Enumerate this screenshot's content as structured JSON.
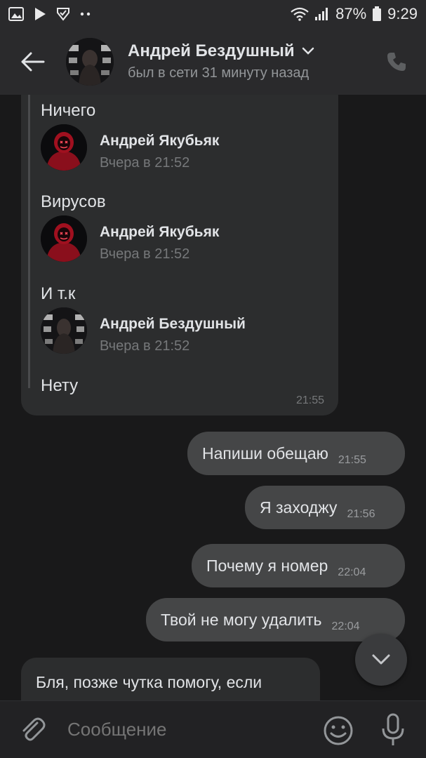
{
  "status_bar": {
    "battery": "87%",
    "time": "9:29",
    "left_icons": [
      "gallery-icon",
      "play-icon",
      "check-shield-icon",
      "more-dots-icon"
    ],
    "right_icons": [
      "wifi-icon",
      "signal-icon",
      "battery-icon"
    ]
  },
  "header": {
    "name": "Андрей Бездушный",
    "status": "был в сети 31 минуту назад",
    "icons": [
      "back-arrow-icon",
      "chevron-down-icon",
      "phone-icon"
    ]
  },
  "forwarded": {
    "top_text": "Ничего",
    "entries": [
      {
        "author": "Андрей Якубьяк",
        "date": "Вчера в 21:52",
        "text": "Вирусов"
      },
      {
        "author": "Андрей Якубьяк",
        "date": "Вчера в 21:52",
        "text": "И т.к"
      },
      {
        "author": "Андрей Бездушный",
        "date": "Вчера в 21:52",
        "text": "Нету"
      }
    ],
    "time": "21:55"
  },
  "outgoing": [
    {
      "text": "Напиши обещаю",
      "time": "21:55"
    },
    {
      "text": "Я заходжу",
      "time": "21:56"
    },
    {
      "text": "Почему я номер",
      "time": "22:04"
    },
    {
      "text": "Твой не могу удалить",
      "time": "22:04"
    }
  ],
  "incoming_last": {
    "text": "Бля, позже чутка помогу, если"
  },
  "composer": {
    "placeholder": "Сообщение",
    "icons": [
      "attach-icon",
      "emoji-icon",
      "mic-icon"
    ]
  },
  "colors": {
    "background": "#19191a",
    "bar": "#2a2a2c",
    "bubble_in": "#2c2d2e",
    "bubble_out": "#454647",
    "text": "#e1e3e6",
    "muted": "#939699"
  }
}
